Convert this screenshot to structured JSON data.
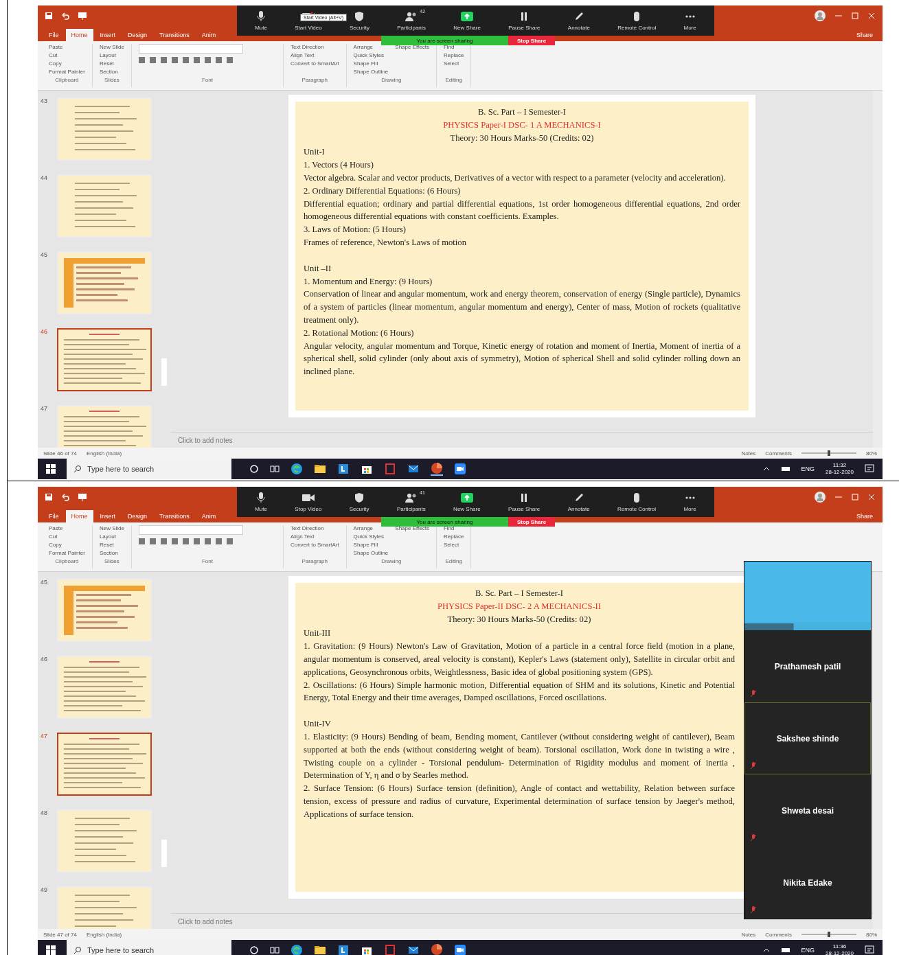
{
  "panels": [
    {
      "zoom_toolbar": {
        "buttons": [
          {
            "kind": "mic",
            "label": "Mute"
          },
          {
            "kind": "video-off",
            "label": "Start Video"
          },
          {
            "kind": "shield",
            "label": "Security"
          },
          {
            "kind": "people",
            "label": "Participants",
            "count": "42"
          },
          {
            "kind": "share",
            "label": "New Share"
          },
          {
            "kind": "pause",
            "label": "Pause Share"
          },
          {
            "kind": "pen",
            "label": "Annotate"
          },
          {
            "kind": "mouse",
            "label": "Remote Control"
          },
          {
            "kind": "more",
            "label": "More"
          }
        ],
        "tooltip": "Start Video (Alt+V)"
      },
      "sharing_banner": "You are screen sharing",
      "stop_share": "Stop Share",
      "ribbon_tabs": [
        {
          "label": "File",
          "selected": false
        },
        {
          "label": "Home",
          "selected": true
        },
        {
          "label": "Insert",
          "selected": false
        },
        {
          "label": "Design",
          "selected": false
        },
        {
          "label": "Transitions",
          "selected": false
        },
        {
          "label": "Anim",
          "selected": false
        }
      ],
      "share_button": "Share",
      "ribbon_groups": [
        {
          "name": "Clipboard",
          "items": [
            "Paste",
            "Cut",
            "Copy",
            "Format Painter"
          ]
        },
        {
          "name": "Slides",
          "items": [
            "New Slide",
            "Layout",
            "Reset",
            "Section"
          ]
        },
        {
          "name": "Font"
        },
        {
          "name": "Paragraph",
          "items": [
            "Text Direction",
            "Align Text",
            "Convert to SmartArt"
          ]
        },
        {
          "name": "Drawing",
          "items": [
            "Arrange",
            "Quick Styles",
            "Shape Fill",
            "Shape Outline",
            "Shape Effects"
          ]
        },
        {
          "name": "Editing",
          "items": [
            "Find",
            "Replace",
            "Select"
          ]
        }
      ],
      "thumbnails": [
        {
          "number": "43",
          "kind": "list",
          "selected": false
        },
        {
          "number": "44",
          "kind": "list",
          "selected": false
        },
        {
          "number": "45",
          "kind": "table",
          "selected": false
        },
        {
          "number": "46",
          "kind": "syllabus",
          "selected": true
        },
        {
          "number": "47",
          "kind": "syllabus",
          "selected": false
        }
      ],
      "slide": {
        "header": [
          "B. Sc. Part – I Semester-I",
          "PHYSICS Paper-I DSC- 1 A MECHANICS-I",
          "Theory: 30 Hours Marks-50 (Credits: 02)"
        ],
        "sections": [
          [
            {
              "kind": "line",
              "text": "Unit-I"
            },
            {
              "kind": "line",
              "text": "1. Vectors (4 Hours)"
            },
            {
              "kind": "para",
              "text": "Vector algebra. Scalar and vector products, Derivatives of a vector with respect to a parameter (velocity and acceleration)."
            },
            {
              "kind": "line",
              "text": "2. Ordinary Differential Equations: (6 Hours)"
            },
            {
              "kind": "para",
              "text": "Differential equation; ordinary and partial differential equations, 1st order homogeneous differential equations, 2nd order homogeneous differential equations with constant coefficients. Examples."
            },
            {
              "kind": "line",
              "text": "3. Laws of Motion: (5 Hours)"
            },
            {
              "kind": "line",
              "text": "Frames of reference, Newton's Laws of motion"
            }
          ],
          [
            {
              "kind": "line",
              "text": "Unit –II"
            },
            {
              "kind": "line",
              "text": "1. Momentum and Energy: (9 Hours)"
            },
            {
              "kind": "para",
              "text": "Conservation of linear and angular momentum, work and energy theorem, conservation of energy (Single particle), Dynamics of a system of particles (linear momentum, angular momentum and energy), Center of mass, Motion of rockets (qualitative treatment only)."
            },
            {
              "kind": "line",
              "text": "2. Rotational Motion: (6 Hours)"
            },
            {
              "kind": "para",
              "text": "Angular velocity, angular momentum and Torque, Kinetic energy of rotation and moment of Inertia, Moment of inertia of a spherical shell, solid cylinder (only about axis of symmetry), Motion of spherical Shell and solid cylinder rolling down an inclined plane."
            }
          ]
        ]
      },
      "notes_placeholder": "Click to add notes",
      "status_bar": {
        "slide": "Slide 46 of 74",
        "language": "English (India)",
        "notes": "Notes",
        "comments": "Comments",
        "zoom": "80%",
        "zoom_slider": {
          "level": 0.5
        }
      },
      "taskbar": {
        "search_placeholder": "Type here to search",
        "language": "ENG",
        "time": "11:32",
        "date": "28-12-2020"
      }
    },
    {
      "zoom_toolbar": {
        "buttons": [
          {
            "kind": "mic",
            "label": "Mute"
          },
          {
            "kind": "video-on",
            "label": "Stop Video"
          },
          {
            "kind": "shield",
            "label": "Security"
          },
          {
            "kind": "people",
            "label": "Participants",
            "count": "41"
          },
          {
            "kind": "share",
            "label": "New Share"
          },
          {
            "kind": "pause",
            "label": "Pause Share"
          },
          {
            "kind": "pen",
            "label": "Annotate"
          },
          {
            "kind": "mouse",
            "label": "Remote Control"
          },
          {
            "kind": "more",
            "label": "More"
          }
        ]
      },
      "sharing_banner": "You are screen sharing",
      "stop_share": "Stop Share",
      "ribbon_tabs": [
        {
          "label": "File",
          "selected": false
        },
        {
          "label": "Home",
          "selected": true
        },
        {
          "label": "Insert",
          "selected": false
        },
        {
          "label": "Design",
          "selected": false
        },
        {
          "label": "Transitions",
          "selected": false
        },
        {
          "label": "Anim",
          "selected": false
        }
      ],
      "share_button": "Share",
      "ribbon_groups": [
        {
          "name": "Clipboard",
          "items": [
            "Paste",
            "Cut",
            "Copy",
            "Format Painter"
          ]
        },
        {
          "name": "Slides",
          "items": [
            "New Slide",
            "Layout",
            "Reset",
            "Section"
          ]
        },
        {
          "name": "Font"
        },
        {
          "name": "Paragraph",
          "items": [
            "Text Direction",
            "Align Text",
            "Convert to SmartArt"
          ]
        },
        {
          "name": "Drawing",
          "items": [
            "Arrange",
            "Quick Styles",
            "Shape Fill",
            "Shape Outline",
            "Shape Effects"
          ]
        },
        {
          "name": "Editing",
          "items": [
            "Find",
            "Replace",
            "Select"
          ]
        }
      ],
      "thumbnails": [
        {
          "number": "45",
          "kind": "table",
          "selected": false
        },
        {
          "number": "46",
          "kind": "syllabus",
          "selected": false
        },
        {
          "number": "47",
          "kind": "syllabus",
          "selected": true
        },
        {
          "number": "48",
          "kind": "list",
          "selected": false
        },
        {
          "number": "49",
          "kind": "list",
          "selected": false
        }
      ],
      "slide": {
        "header": [
          "B. Sc. Part – I Semester-I",
          "PHYSICS Paper-II DSC- 2 A MECHANICS-II",
          "Theory: 30 Hours Marks-50 (Credits: 02)"
        ],
        "sections": [
          [
            {
              "kind": "line",
              "text": "Unit-III"
            },
            {
              "kind": "para",
              "text": "1. Gravitation: (9 Hours) Newton's Law of Gravitation, Motion of a particle in a central force field (motion in a plane, angular momentum is conserved, areal velocity is constant), Kepler's Laws (statement only), Satellite in circular orbit and applications, Geosynchronous orbits, Weightlessness, Basic idea of global positioning system (GPS)."
            },
            {
              "kind": "para",
              "text": "2. Oscillations: (6 Hours) Simple harmonic motion, Differential equation of SHM and its solutions, Kinetic and Potential Energy, Total Energy and their time averages, Damped oscillations, Forced oscillations."
            }
          ],
          [
            {
              "kind": "line",
              "text": "Unit-IV"
            },
            {
              "kind": "para",
              "text": "1. Elasticity: (9 Hours) Bending of beam, Bending moment, Cantilever (without considering weight of cantilever), Beam supported at both the ends (without considering weight of beam). Torsional oscillation, Work done in twisting a wire , Twisting couple on a cylinder - Torsional pendulum- Determination of Rigidity modulus and moment of inertia , Determination of Y, η and σ by Searles method."
            },
            {
              "kind": "para",
              "text": "2. Surface Tension: (6 Hours) Surface tension (definition), Angle of contact and wettability, Relation between surface tension, excess of pressure and radius of curvature, Experimental determination of surface tension by Jaeger's method, Applications of surface tension."
            }
          ]
        ]
      },
      "participants": [
        {
          "name": "Prathamesh patil",
          "muted": true,
          "speaking": false
        },
        {
          "name": "Sakshee shinde",
          "muted": true,
          "speaking": true
        },
        {
          "name": "Shweta desai",
          "muted": true,
          "speaking": false
        },
        {
          "name": "Nikita Edake",
          "muted": true,
          "speaking": false
        }
      ],
      "notes_placeholder": "Click to add notes",
      "status_bar": {
        "slide": "Slide 47 of 74",
        "language": "English (India)",
        "notes": "Notes",
        "comments": "Comments",
        "zoom": "80%",
        "zoom_slider": {
          "level": 0.5
        }
      },
      "taskbar": {
        "search_placeholder": "Type here to search",
        "language": "ENG",
        "time": "11:36",
        "date": "28-12-2020"
      }
    }
  ]
}
